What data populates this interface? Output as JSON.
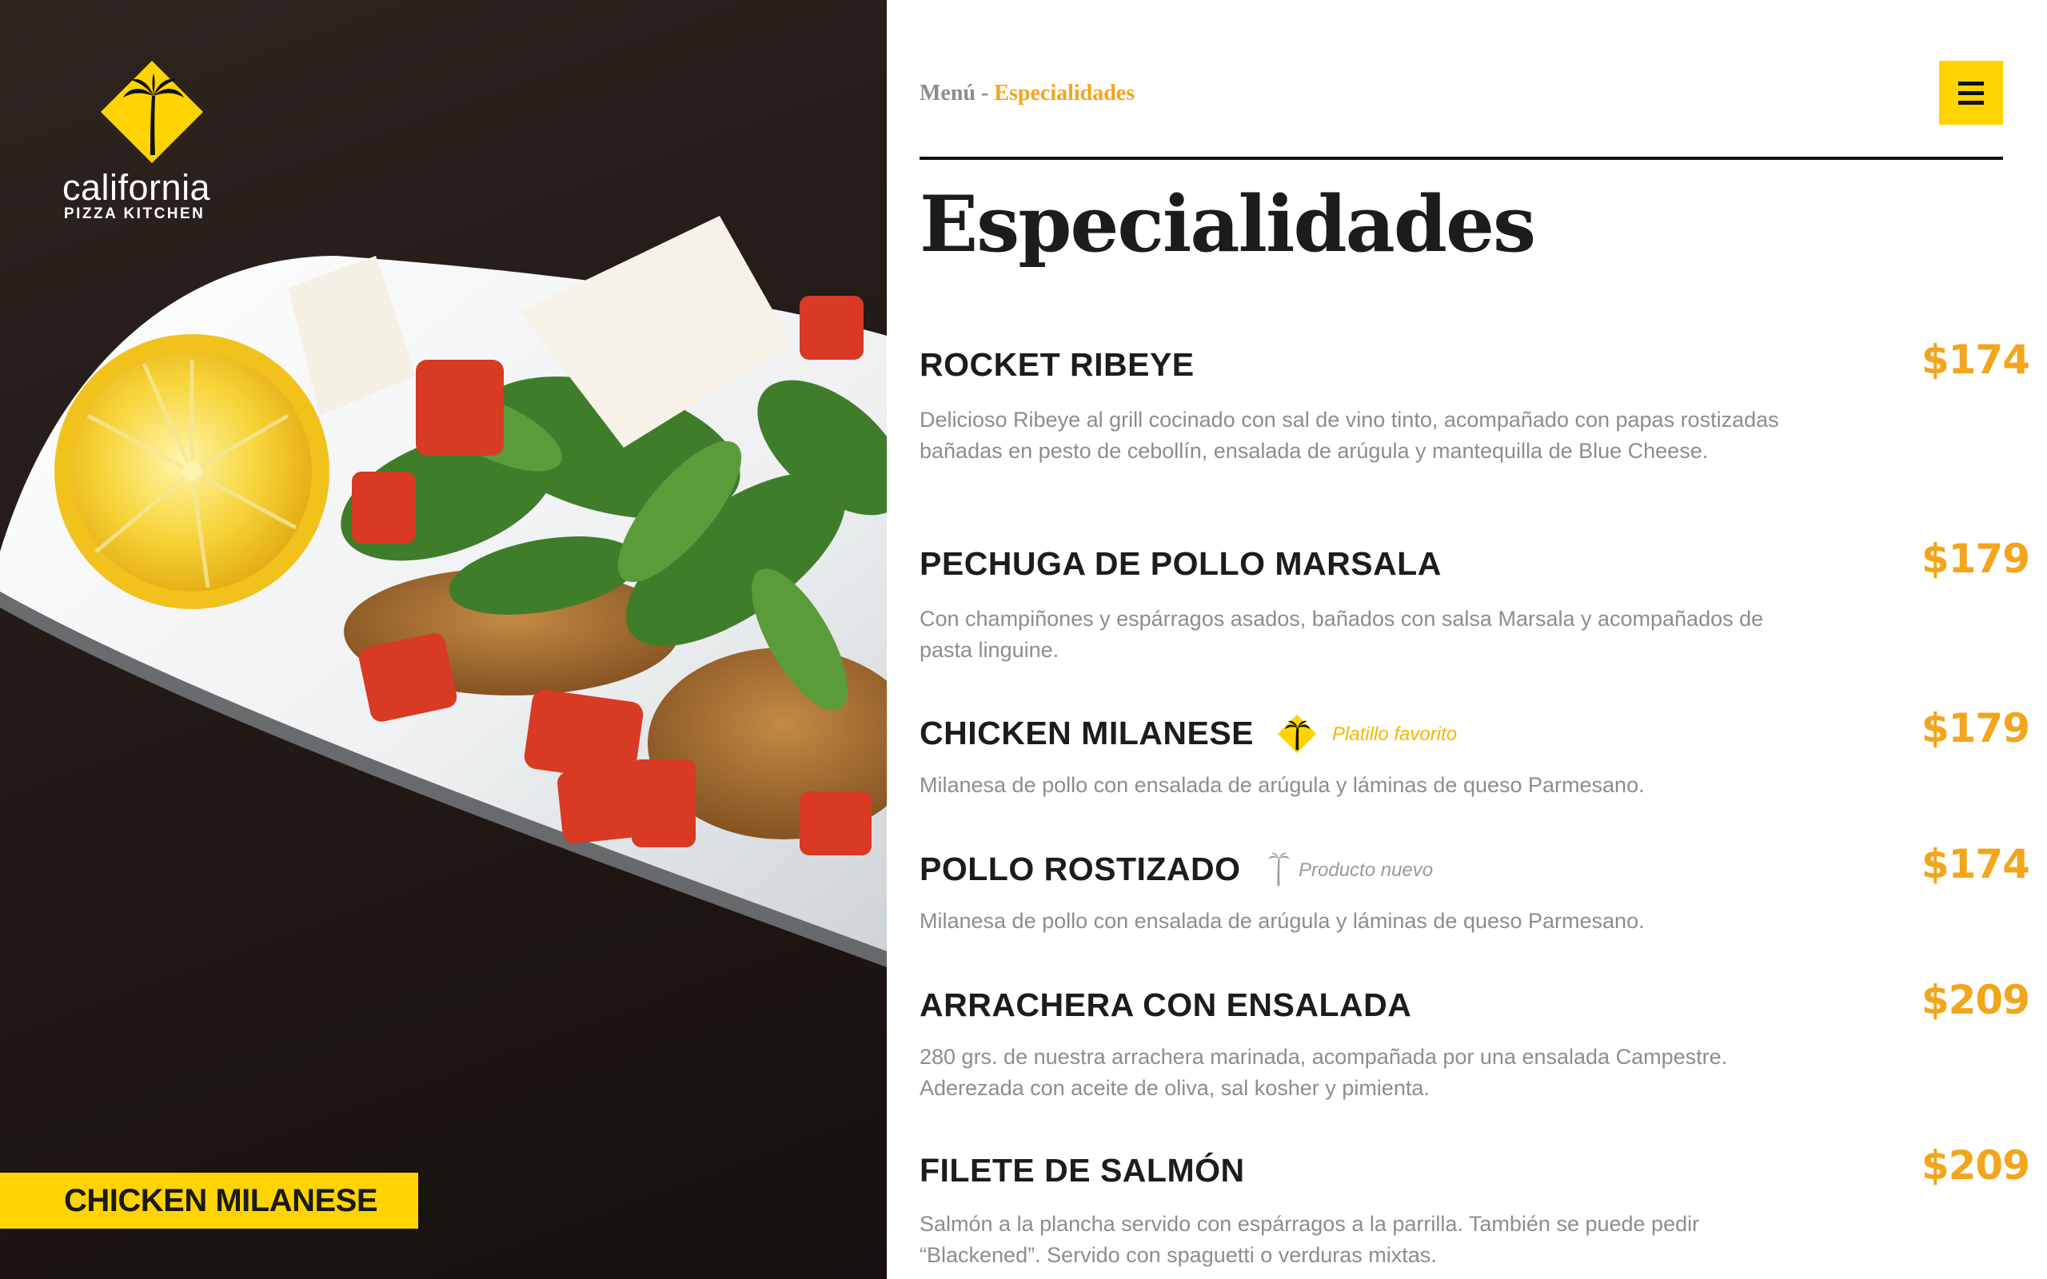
{
  "brand": {
    "wordmark": "california",
    "subline": "PIZZA KITCHEN",
    "logo_icon": "palm-tree-diamond-icon",
    "yellow": "#ffd400"
  },
  "featured_dish": {
    "label": "CHICKEN MILANESE"
  },
  "header": {
    "breadcrumb_root": "Menú",
    "breadcrumb_separator": "-",
    "breadcrumb_current": "Especialidades",
    "menu_icon": "hamburger-menu-icon"
  },
  "page_title": "Especialidades",
  "colors": {
    "accent_orange": "#f3a51b",
    "accent_yellow": "#ffd400",
    "text_dark": "#1c1c1c",
    "text_gray": "#8d8d8d"
  },
  "items": [
    {
      "name": "ROCKET RIBEYE",
      "price": "$174",
      "description": "Delicioso Ribeye al grill cocinado con sal de vino tinto, acompañado con papas rostizadas bañadas en pesto de cebollín, ensalada de arúgula y mantequilla de Blue Cheese."
    },
    {
      "name": "PECHUGA DE POLLO MARSALA",
      "price": "$179",
      "description": "Con champiñones y espárragos asados, bañados con salsa Marsala y acompañados de pasta linguine."
    },
    {
      "name": "CHICKEN MILANESE",
      "price": "$179",
      "badge": "Platillo favorito",
      "badge_icon": "palm-tree-diamond-icon",
      "description": "Milanesa de pollo con ensalada de arúgula y láminas de queso Parmesano."
    },
    {
      "name": "POLLO ROSTIZADO",
      "price": "$174",
      "badge": "Producto nuevo",
      "badge_icon": "palm-tree-icon",
      "description": "Milanesa de pollo con ensalada de arúgula y láminas de queso Parmesano."
    },
    {
      "name": "ARRACHERA CON ENSALADA",
      "price": "$209",
      "description": "280 grs. de nuestra arrachera marinada, acompañada por una ensalada Campestre. Aderezada con aceite de oliva, sal kosher y pimienta."
    },
    {
      "name": "FILETE DE SALMÓN",
      "price": "$209",
      "description": "Salmón a la plancha servido con espárragos a la parrilla. También se puede pedir “Blackened”. Servido con spaguetti o verduras mixtas."
    }
  ]
}
